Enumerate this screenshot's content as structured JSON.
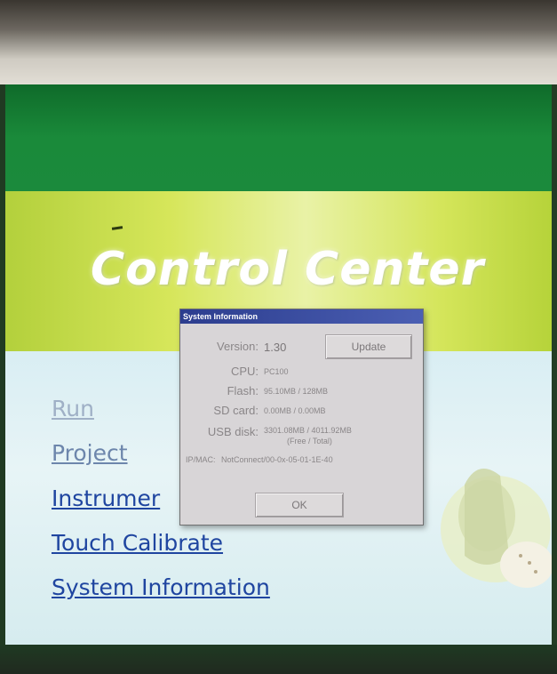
{
  "screen": {
    "title": "Control Center",
    "menu": [
      {
        "label": "Run"
      },
      {
        "label": "Project"
      },
      {
        "label": "Instrumer"
      },
      {
        "label": "Touch Calibrate"
      },
      {
        "label": "System Information"
      }
    ]
  },
  "dialog": {
    "title": "System Information",
    "version_label": "Version:",
    "version_value": "1.30",
    "update_button": "Update",
    "cpu_label": "CPU:",
    "cpu_value": "PC100",
    "flash_label": "Flash:",
    "flash_value": "95.10MB / 128MB",
    "sdcard_label": "SD card:",
    "sdcard_value": "0.00MB / 0.00MB",
    "usb_label": "USB disk:",
    "usb_value": "3301.08MB / 4011.92MB",
    "usb_note": "(Free / Total)",
    "ip_label": "IP/MAC:",
    "ip_value": "NotConnect/00-0x-05-01-1E-40",
    "ok_button": "OK"
  },
  "colors": {
    "header_green": "#1a8a3a",
    "link_blue": "#1f45a0",
    "titlebar_blue": "#2c3d8e"
  }
}
